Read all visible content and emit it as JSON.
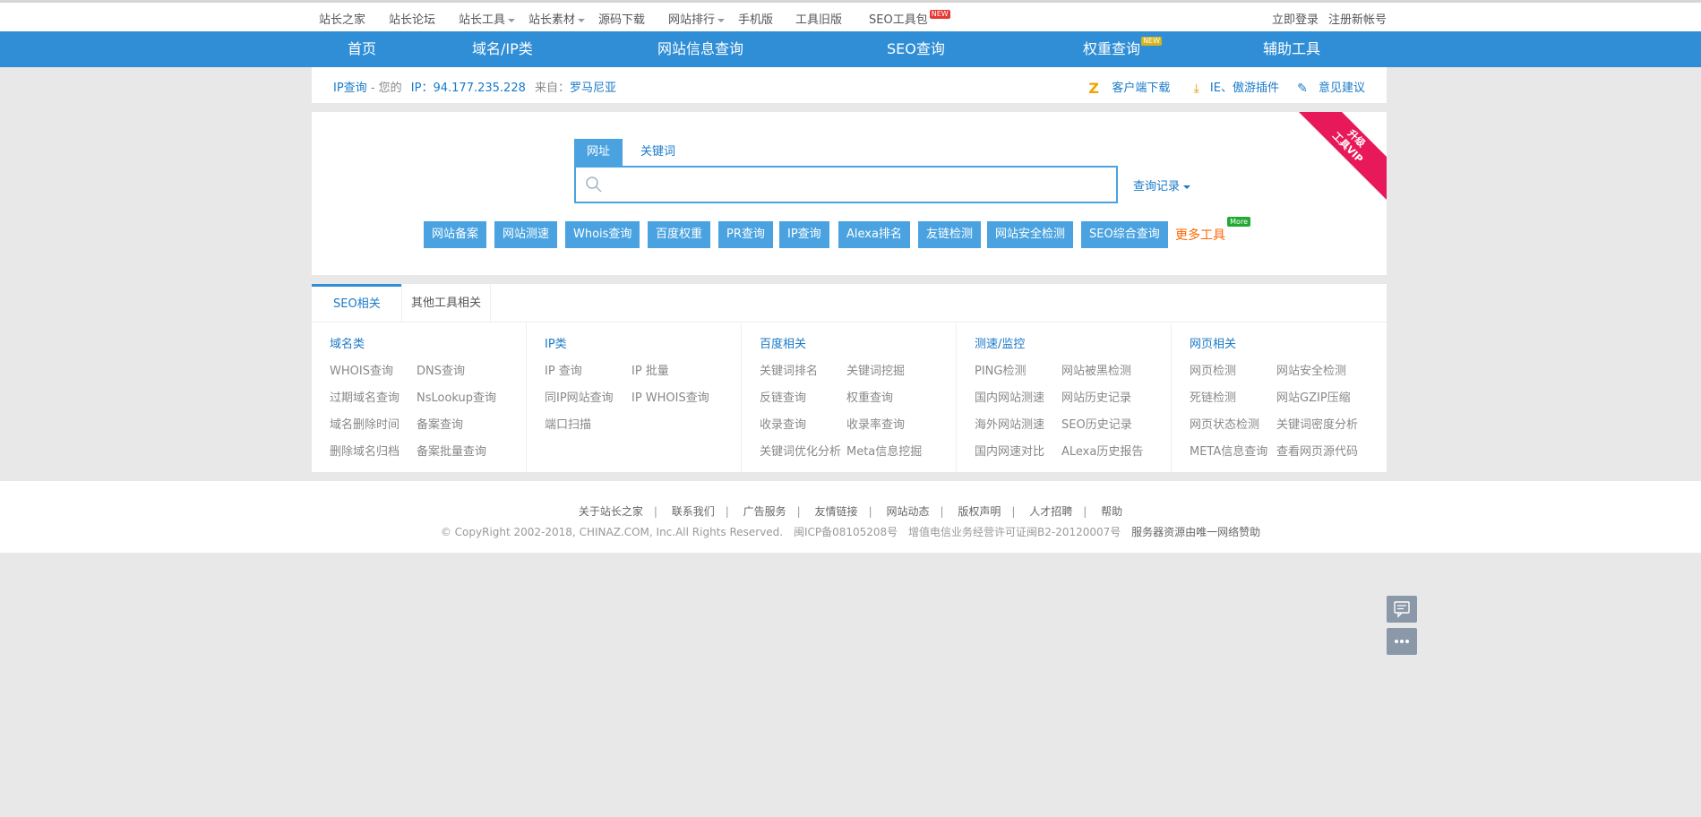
{
  "topnav": {
    "items": [
      {
        "label": "站长之家"
      },
      {
        "label": "站长论坛"
      },
      {
        "label": "站长工具"
      },
      {
        "label": "站长素材"
      },
      {
        "label": "源码下载"
      },
      {
        "label": "网站排行"
      },
      {
        "label": "手机版"
      },
      {
        "label": "工具旧版"
      },
      {
        "label": "SEO工具包"
      }
    ],
    "new_badge": "NEW",
    "login": "立即登录",
    "register": "注册新帐号"
  },
  "mainnav": {
    "items": [
      {
        "label": "首页"
      },
      {
        "label": "域名/IP类"
      },
      {
        "label": "网站信息查询"
      },
      {
        "label": "SEO查询"
      },
      {
        "label": "权重查询"
      },
      {
        "label": "辅助工具"
      }
    ],
    "new_tag": "NEW"
  },
  "ipbar": {
    "ip_query": "IP查询",
    "yours": "- 您的",
    "ip_label": "IP：",
    "ip": "94.177.235.228",
    "from_label": "来自：",
    "from": "罗马尼亚",
    "client_download": "客户端下载",
    "plugin": "IE、傲游插件",
    "feedback": "意见建议"
  },
  "search": {
    "tab_url": "网址",
    "tab_keyword": "关键词",
    "placeholder": "",
    "history": "查询记录",
    "vip_line1": "升级",
    "vip_line2": "工具VIP"
  },
  "quick_buttons": [
    "网站备案",
    "网站测速",
    "Whois查询",
    "百度权重",
    "PR查询",
    "IP查询",
    "Alexa排名",
    "友链检测",
    "网站安全检测",
    "SEO综合查询"
  ],
  "more_tools": {
    "label": "更多工具",
    "tag": "More"
  },
  "categories": {
    "tab_seo": "SEO相关",
    "tab_other": "其他工具相关",
    "columns": [
      {
        "title": "域名类",
        "links": [
          "WHOIS查询",
          "DNS查询",
          "过期域名查询",
          "NsLookup查询",
          "域名删除时间",
          "备案查询",
          "删除域名归档",
          "备案批量查询"
        ]
      },
      {
        "title": "IP类",
        "links": [
          "IP 查询",
          "IP 批量",
          "同IP网站查询",
          "IP WHOIS查询",
          "端口扫描"
        ]
      },
      {
        "title": "百度相关",
        "links": [
          "关键词排名",
          "关键词挖掘",
          "反链查询",
          "权重查询",
          "收录查询",
          "收录率查询",
          "关键词优化分析",
          "Meta信息挖掘"
        ]
      },
      {
        "title": "测速/监控",
        "links": [
          "PING检测",
          "网站被黑检测",
          "国内网站测速",
          "网站历史记录",
          "海外网站测速",
          "SEO历史记录",
          "国内网速对比",
          "ALexa历史报告"
        ]
      },
      {
        "title": "网页相关",
        "links": [
          "网页检测",
          "网站安全检测",
          "死链检测",
          "网站GZIP压缩",
          "网页状态检测",
          "关键词密度分析",
          "META信息查询",
          "查看网页源代码"
        ]
      }
    ]
  },
  "footer": {
    "links": [
      "关于站长之家",
      "联系我们",
      "广告服务",
      "友情链接",
      "网站动态",
      "版权声明",
      "人才招聘",
      "帮助"
    ],
    "sep": "|",
    "copyright": "© CopyRight 2002-2018, CHINAZ.COM, Inc.All Rights Reserved.",
    "icp": "闽ICP备08105208号",
    "license": "增值电信业务经营许可证闽B2-20120007号",
    "sponsor": "服务器资源由唯一网络赞助"
  }
}
